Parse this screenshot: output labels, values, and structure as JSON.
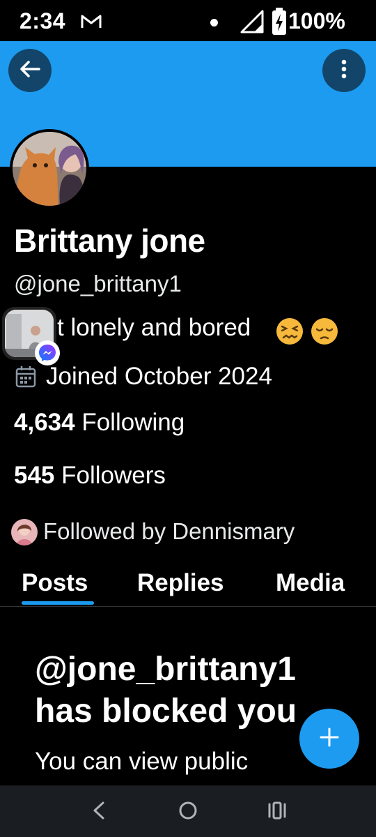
{
  "status_bar": {
    "time": "2:34",
    "battery": "100%",
    "icons": [
      "gmail-icon",
      "notification-dot-icon",
      "signal-icon",
      "battery-charging-icon"
    ]
  },
  "header": {
    "back_icon": "arrow-left-icon",
    "more_icon": "more-vertical-icon",
    "banner_color": "#1d9bf0"
  },
  "profile": {
    "name": "Brittany jone",
    "handle": "@jone_brittany1",
    "bio": "t lonely and bored",
    "bio_emojis": [
      "confounded-face",
      "pensive-face"
    ],
    "joined": "Joined October 2024",
    "following_count": "4,634",
    "following_label": "Following",
    "followers_count": "545",
    "followers_label": "Followers",
    "followed_by": "Followed by Dennismary"
  },
  "tabs": [
    {
      "label": "Posts",
      "active": true
    },
    {
      "label": "Replies",
      "active": false
    },
    {
      "label": "Media",
      "active": false
    }
  ],
  "blocked": {
    "title_line1": "@jone_brittany1",
    "title_line2": "has blocked you",
    "subtitle": "You can view public"
  },
  "fab": {
    "icon": "plus-icon"
  },
  "nav": {
    "icons": [
      "back-triangle-icon",
      "home-circle-icon",
      "recents-icon"
    ]
  },
  "accent": "#1d9bf0"
}
